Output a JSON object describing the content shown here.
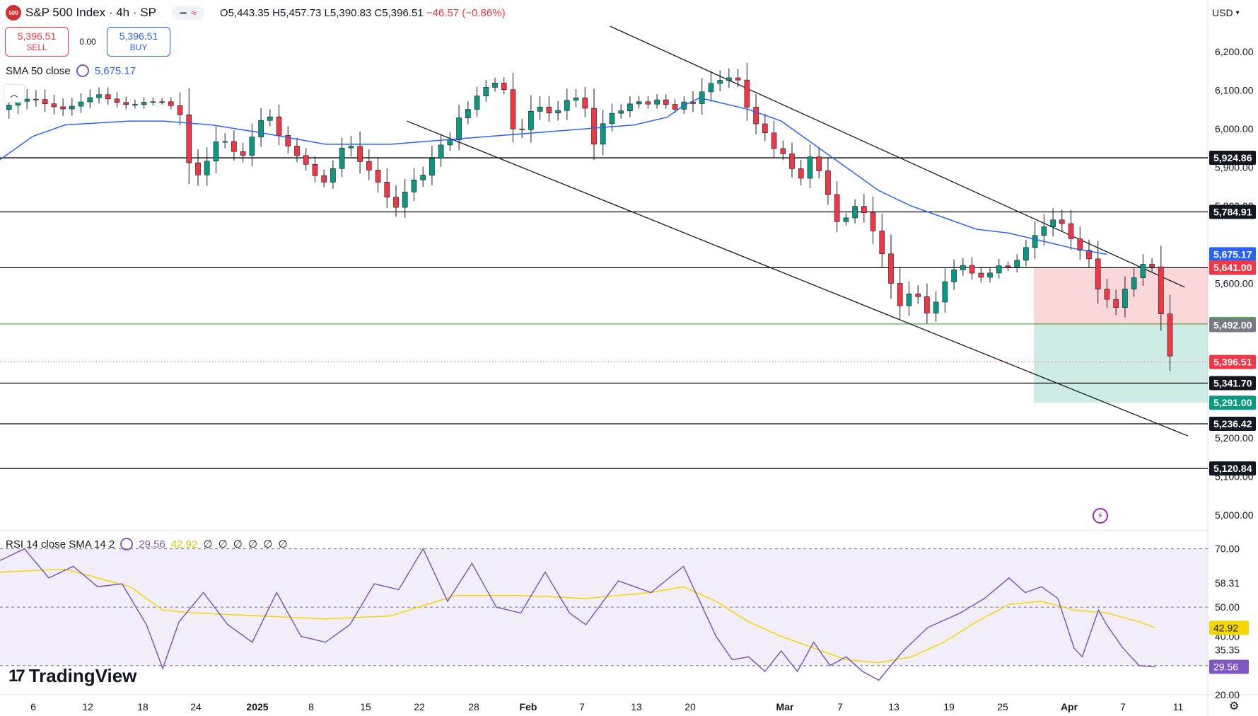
{
  "header": {
    "logo_text": "500",
    "title": "S&P 500 Index · 4h · SP",
    "ohlc": "O5,443.35 H5,457.73 L5,390.83 C5,396.51",
    "change": "−46.57 (−0.86%)"
  },
  "trade": {
    "sell_price": "5,396.51",
    "sell_label": "SELL",
    "spread": "0.00",
    "buy_price": "5,396.51",
    "buy_label": "BUY"
  },
  "sma_legend": {
    "label": "SMA 50 close",
    "value": "5,675.17"
  },
  "rsi_legend": {
    "label": "RSI 14 close SMA 14 2",
    "rsi": "29.56",
    "sma": "42.92",
    "extra": "∅ ∅ ∅ ∅ ∅ ∅"
  },
  "currency": "USD",
  "brand": "TradingView",
  "colors": {
    "up": "#089981",
    "down": "#f23645",
    "sma": "#2962ff",
    "rsi": "#7e57c2",
    "rsi_sma": "#f5d600"
  },
  "chart_data": {
    "type": "candlestick",
    "y_ticks": [
      "6,200.00",
      "6,100.00",
      "6,000.00",
      "5,900.00",
      "5,800.00",
      "5,600.00",
      "5,200.00",
      "5,100.00",
      "5,000.00"
    ],
    "ylim": [
      4960,
      6260
    ],
    "x_ticks": [
      "6",
      "12",
      "18",
      "24",
      "2025",
      "8",
      "15",
      "22",
      "28",
      "Feb",
      "7",
      "13",
      "20",
      "Mar",
      "7",
      "13",
      "19",
      "25",
      "Apr",
      "7",
      "11"
    ],
    "horizontal_levels": [
      {
        "value": 5924.86,
        "label": "5,924.86",
        "color": "#000000"
      },
      {
        "value": 5784.91,
        "label": "5,784.91",
        "color": "#000000"
      },
      {
        "value": 5640.43,
        "label": "5,640.43",
        "color": "#000000"
      },
      {
        "value": 5494.85,
        "label": "5,494.85",
        "color": "#4caf50"
      },
      {
        "value": 5341.7,
        "label": "5,341.70",
        "color": "#000000"
      },
      {
        "value": 5236.42,
        "label": "5,236.42",
        "color": "#000000"
      },
      {
        "value": 5120.84,
        "label": "5,120.84",
        "color": "#000000"
      }
    ],
    "price_labels": [
      {
        "value": 5675.17,
        "label": "5,675.17",
        "color": "#2962ff"
      },
      {
        "value": 5641.0,
        "label": "5,641.00",
        "color": "#f23645"
      },
      {
        "value": 5492.0,
        "label": "5,492.00",
        "color": "#787b86"
      },
      {
        "value": 5396.51,
        "label": "5,396.51",
        "color": "#f23645"
      },
      {
        "value": 5291.0,
        "label": "5,291.00",
        "color": "#089981"
      }
    ],
    "position": {
      "entry": 5492.0,
      "stop": 5641.0,
      "target": 5291.0
    },
    "last_close": 5396.51,
    "close_path": [
      [
        0,
        6050
      ],
      [
        10,
        6070
      ],
      [
        20,
        6080
      ],
      [
        30,
        6060
      ],
      [
        40,
        6050
      ],
      [
        50,
        6070
      ],
      [
        60,
        6090
      ],
      [
        70,
        6070
      ],
      [
        80,
        6060
      ],
      [
        90,
        6070
      ],
      [
        100,
        6070
      ],
      [
        110,
        6050
      ],
      [
        118,
        5870
      ],
      [
        125,
        5890
      ],
      [
        130,
        5950
      ],
      [
        135,
        5980
      ],
      [
        140,
        5960
      ],
      [
        148,
        5920
      ],
      [
        155,
        5980
      ],
      [
        160,
        6020
      ],
      [
        165,
        6040
      ],
      [
        170,
        5990
      ],
      [
        178,
        5950
      ],
      [
        185,
        5920
      ],
      [
        190,
        5900
      ],
      [
        195,
        5870
      ],
      [
        200,
        5860
      ],
      [
        205,
        5900
      ],
      [
        210,
        5950
      ],
      [
        215,
        5960
      ],
      [
        220,
        5920
      ],
      [
        225,
        5900
      ],
      [
        230,
        5880
      ],
      [
        235,
        5840
      ],
      [
        240,
        5810
      ],
      [
        245,
        5790
      ],
      [
        250,
        5850
      ],
      [
        255,
        5870
      ],
      [
        260,
        5880
      ],
      [
        265,
        5920
      ],
      [
        270,
        5960
      ],
      [
        275,
        5950
      ],
      [
        280,
        6020
      ],
      [
        285,
        6040
      ],
      [
        290,
        6060
      ],
      [
        295,
        6100
      ],
      [
        300,
        6110
      ],
      [
        305,
        6120
      ],
      [
        310,
        6100
      ],
      [
        315,
        6000
      ],
      [
        320,
        5990
      ],
      [
        325,
        6040
      ],
      [
        330,
        6060
      ],
      [
        335,
        6050
      ],
      [
        340,
        6030
      ],
      [
        345,
        6060
      ],
      [
        350,
        6080
      ],
      [
        355,
        6080
      ],
      [
        360,
        6050
      ],
      [
        365,
        5960
      ],
      [
        370,
        6010
      ],
      [
        375,
        6040
      ],
      [
        380,
        6040
      ],
      [
        385,
        6060
      ],
      [
        390,
        6070
      ],
      [
        395,
        6070
      ],
      [
        400,
        6060
      ],
      [
        405,
        6080
      ],
      [
        410,
        6060
      ],
      [
        415,
        6050
      ],
      [
        420,
        6070
      ],
      [
        425,
        6060
      ],
      [
        430,
        6090
      ],
      [
        435,
        6110
      ],
      [
        440,
        6130
      ],
      [
        445,
        6120
      ],
      [
        450,
        6140
      ],
      [
        455,
        6120
      ],
      [
        460,
        6040
      ],
      [
        465,
        6010
      ],
      [
        470,
        5990
      ],
      [
        475,
        5950
      ],
      [
        480,
        5940
      ],
      [
        485,
        5920
      ],
      [
        490,
        5850
      ],
      [
        495,
        5900
      ],
      [
        500,
        5950
      ],
      [
        505,
        5860
      ],
      [
        510,
        5820
      ],
      [
        515,
        5750
      ],
      [
        520,
        5770
      ],
      [
        525,
        5800
      ],
      [
        530,
        5790
      ],
      [
        535,
        5750
      ],
      [
        540,
        5700
      ],
      [
        545,
        5640
      ],
      [
        550,
        5560
      ],
      [
        555,
        5530
      ],
      [
        560,
        5590
      ],
      [
        565,
        5560
      ],
      [
        570,
        5520
      ],
      [
        575,
        5550
      ],
      [
        580,
        5600
      ],
      [
        585,
        5630
      ],
      [
        590,
        5650
      ],
      [
        595,
        5640
      ],
      [
        600,
        5610
      ],
      [
        605,
        5620
      ],
      [
        610,
        5630
      ],
      [
        615,
        5650
      ],
      [
        620,
        5640
      ],
      [
        625,
        5660
      ],
      [
        630,
        5690
      ],
      [
        635,
        5720
      ],
      [
        640,
        5740
      ],
      [
        645,
        5760
      ],
      [
        650,
        5770
      ],
      [
        655,
        5740
      ],
      [
        660,
        5700
      ],
      [
        665,
        5680
      ],
      [
        670,
        5660
      ],
      [
        675,
        5580
      ],
      [
        680,
        5560
      ],
      [
        685,
        5530
      ],
      [
        690,
        5580
      ],
      [
        695,
        5600
      ],
      [
        700,
        5640
      ],
      [
        705,
        5660
      ],
      [
        710,
        5630
      ],
      [
        715,
        5470
      ],
      [
        720,
        5396.51
      ]
    ],
    "sma_path": [
      [
        0,
        5920
      ],
      [
        20,
        5980
      ],
      [
        40,
        6010
      ],
      [
        60,
        6015
      ],
      [
        80,
        6020
      ],
      [
        100,
        6020
      ],
      [
        130,
        6010
      ],
      [
        160,
        5990
      ],
      [
        200,
        5960
      ],
      [
        240,
        5960
      ],
      [
        270,
        5970
      ],
      [
        300,
        5980
      ],
      [
        330,
        5990
      ],
      [
        360,
        6000
      ],
      [
        390,
        6010
      ],
      [
        410,
        6030
      ],
      [
        420,
        6060
      ],
      [
        430,
        6080
      ],
      [
        440,
        6070
      ],
      [
        460,
        6050
      ],
      [
        480,
        6020
      ],
      [
        500,
        5960
      ],
      [
        520,
        5900
      ],
      [
        540,
        5840
      ],
      [
        560,
        5800
      ],
      [
        580,
        5770
      ],
      [
        600,
        5740
      ],
      [
        620,
        5730
      ],
      [
        640,
        5710
      ],
      [
        660,
        5690
      ],
      [
        680,
        5675.17
      ]
    ],
    "channel": [
      {
        "from": [
          375,
          6265
        ],
        "to": [
          728,
          5590
        ]
      },
      {
        "from": [
          250,
          6020
        ],
        "to": [
          730,
          5205
        ]
      }
    ],
    "rsi": {
      "ylim": [
        20,
        75
      ],
      "y_ticks": [
        "70.00",
        "58.31",
        "50.00",
        "40.00",
        "35.35",
        "20.00"
      ],
      "levels": [
        70,
        50,
        30
      ],
      "labels": [
        {
          "value": 42.92,
          "label": "42.92",
          "color": "#f5d600"
        },
        {
          "value": 29.56,
          "label": "29.56",
          "color": "#7e57c2"
        }
      ],
      "rsi_path": [
        [
          0,
          66
        ],
        [
          15,
          70
        ],
        [
          30,
          60
        ],
        [
          45,
          64
        ],
        [
          60,
          57
        ],
        [
          75,
          58
        ],
        [
          90,
          44
        ],
        [
          100,
          29
        ],
        [
          110,
          45
        ],
        [
          125,
          55
        ],
        [
          140,
          44
        ],
        [
          155,
          38
        ],
        [
          170,
          55
        ],
        [
          185,
          40
        ],
        [
          200,
          38
        ],
        [
          215,
          44
        ],
        [
          230,
          58
        ],
        [
          245,
          56
        ],
        [
          260,
          70
        ],
        [
          275,
          52
        ],
        [
          290,
          65
        ],
        [
          305,
          50
        ],
        [
          320,
          48
        ],
        [
          335,
          62
        ],
        [
          350,
          48
        ],
        [
          360,
          44
        ],
        [
          380,
          59
        ],
        [
          400,
          55
        ],
        [
          420,
          64
        ],
        [
          430,
          52
        ],
        [
          440,
          40
        ],
        [
          450,
          32
        ],
        [
          460,
          33
        ],
        [
          470,
          28
        ],
        [
          480,
          35
        ],
        [
          490,
          28
        ],
        [
          500,
          38
        ],
        [
          510,
          30
        ],
        [
          520,
          33
        ],
        [
          530,
          28
        ],
        [
          540,
          25
        ],
        [
          555,
          35
        ],
        [
          570,
          43
        ],
        [
          590,
          48
        ],
        [
          605,
          53
        ],
        [
          620,
          60
        ],
        [
          630,
          55
        ],
        [
          640,
          57
        ],
        [
          650,
          53
        ],
        [
          660,
          36
        ],
        [
          665,
          33
        ],
        [
          675,
          49
        ],
        [
          680,
          44
        ],
        [
          690,
          36
        ],
        [
          700,
          30
        ],
        [
          710,
          29.56
        ]
      ],
      "sma_path": [
        [
          0,
          62
        ],
        [
          40,
          63
        ],
        [
          80,
          57
        ],
        [
          100,
          49
        ],
        [
          120,
          48
        ],
        [
          160,
          47
        ],
        [
          200,
          46
        ],
        [
          240,
          47
        ],
        [
          280,
          54
        ],
        [
          320,
          54
        ],
        [
          360,
          53
        ],
        [
          400,
          55
        ],
        [
          420,
          57
        ],
        [
          440,
          52
        ],
        [
          460,
          45
        ],
        [
          480,
          40
        ],
        [
          500,
          36
        ],
        [
          520,
          32
        ],
        [
          540,
          31
        ],
        [
          560,
          33
        ],
        [
          580,
          38
        ],
        [
          600,
          45
        ],
        [
          620,
          51
        ],
        [
          640,
          52
        ],
        [
          660,
          49
        ],
        [
          680,
          48
        ],
        [
          700,
          45
        ],
        [
          710,
          42.92
        ]
      ]
    }
  }
}
